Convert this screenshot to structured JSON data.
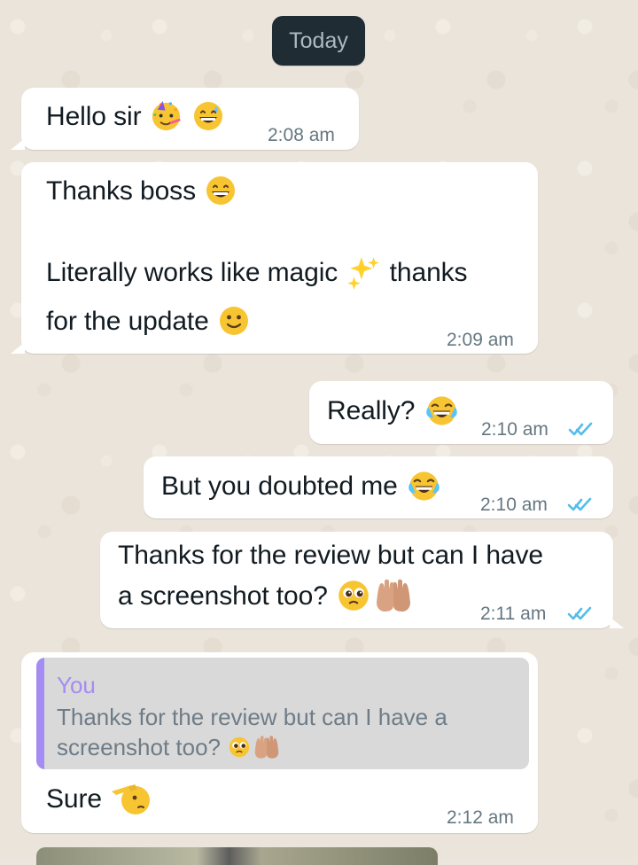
{
  "date_separator": "Today",
  "messages": [
    {
      "direction": "incoming",
      "text": "Hello sir",
      "time": "2:08 am"
    },
    {
      "direction": "incoming",
      "lines": [
        "Thanks boss",
        "Literally works like magic",
        "thanks",
        "for the update"
      ],
      "time": "2:09 am"
    },
    {
      "direction": "outgoing",
      "text": "Really?",
      "time": "2:10 am"
    },
    {
      "direction": "outgoing",
      "text": "But you doubted me",
      "time": "2:10 am"
    },
    {
      "direction": "outgoing",
      "lines": [
        "Thanks for the review but can I have",
        "a screenshot too?"
      ],
      "time": "2:11 am"
    },
    {
      "direction": "incoming",
      "reply": {
        "author": "You",
        "lines": [
          "Thanks for the review but can I have a",
          "screenshot too?"
        ]
      },
      "text": "Sure",
      "time": "2:12 am"
    }
  ],
  "colors": {
    "bubble": "#ffffff",
    "time": "#667781",
    "read_ticks": "#53bdeb",
    "quote_author": "#a58cf2"
  },
  "icons": [
    "party-face-emoji",
    "grinning-sweat-emoji",
    "grinning-face-emoji",
    "sparkles-emoji",
    "smiling-face-emoji",
    "tears-of-joy-emoji",
    "pleading-face-emoji",
    "palms-up-together-emoji",
    "saluting-face-emoji",
    "double-check-read-icon"
  ]
}
